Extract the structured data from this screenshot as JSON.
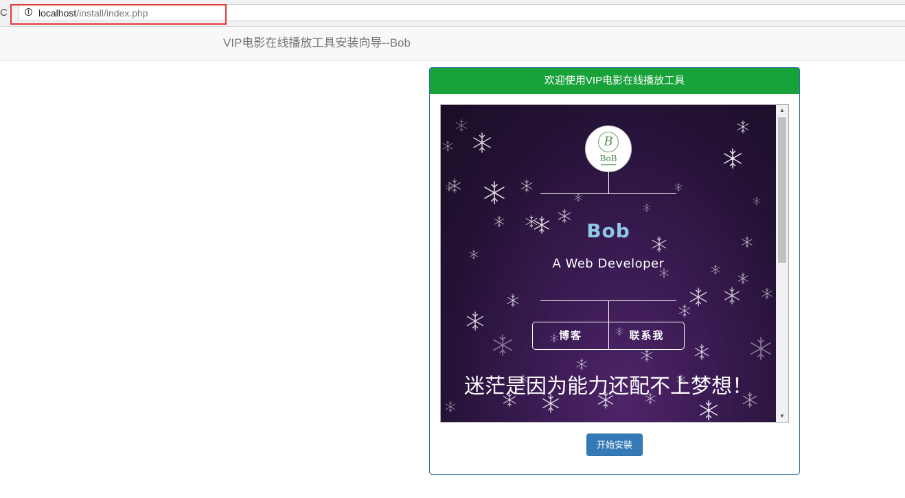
{
  "browser": {
    "reload_glyph": "C",
    "info_glyph": "i",
    "url_host": "localhost",
    "url_path": "/install/index.php"
  },
  "navbar": {
    "brand": "VIP电影在线播放工具安装向导--Bob"
  },
  "panel": {
    "heading": "欢迎使用VIP电影在线播放工具",
    "install_button": "开始安装"
  },
  "preview": {
    "logo_mark": "B",
    "logo_text": "BoB",
    "name": "Bob",
    "tagline": "A Web Developer",
    "buttons": [
      "博客",
      "联系我"
    ],
    "motto": "迷茫是因为能力还配不上梦想！",
    "scroll_up": "▲",
    "scroll_down": "▼"
  },
  "colors": {
    "panel_heading": "#18a33a",
    "primary_button": "#337ab7",
    "url_highlight": "#e0393b",
    "stage_bg": "#2a1440"
  }
}
